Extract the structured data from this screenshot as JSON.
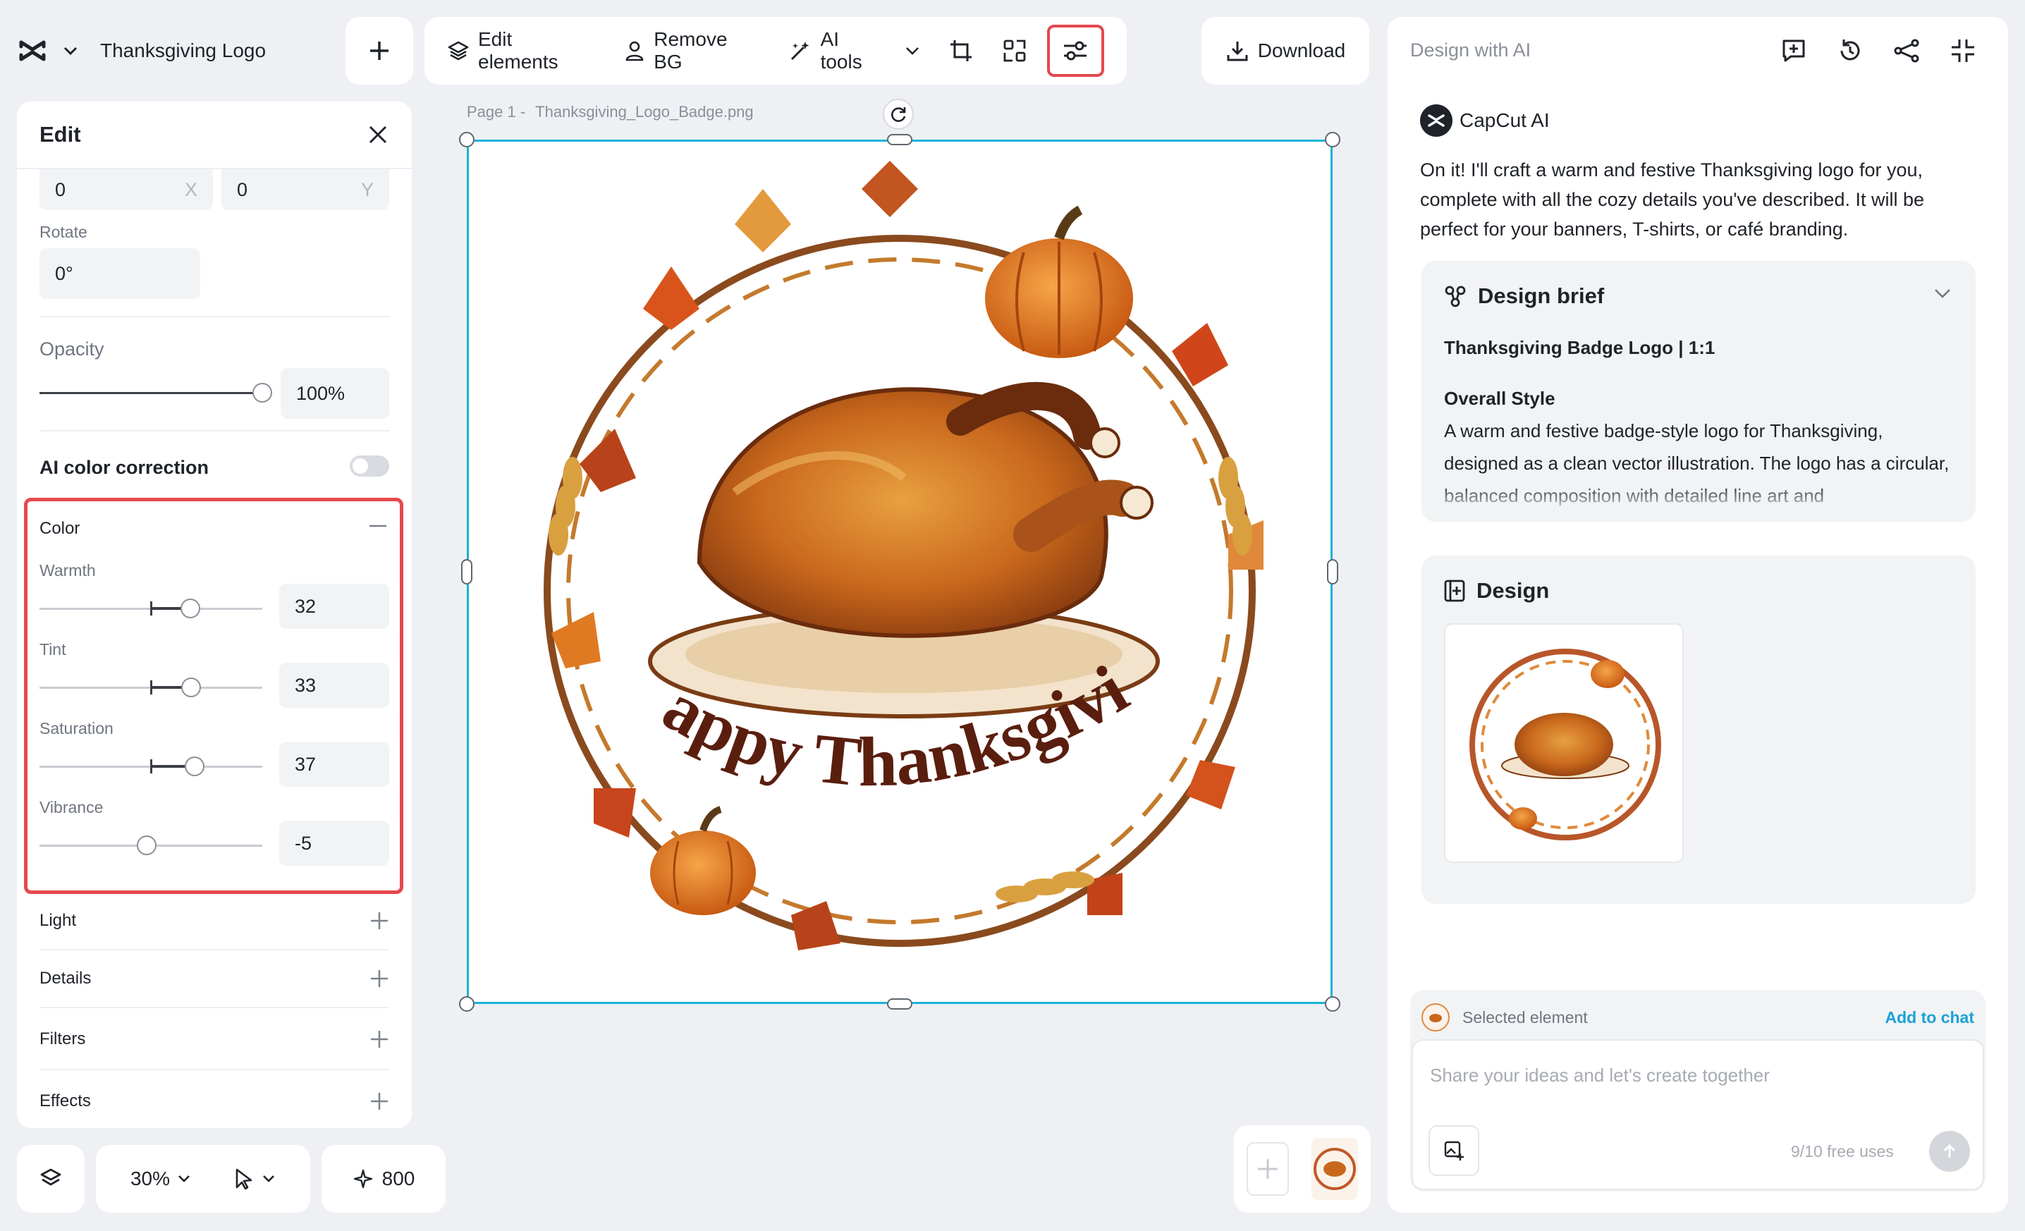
{
  "app": {
    "logo_icon": "capcut-logo-icon",
    "project_title": "Thanksgiving Logo"
  },
  "toolbar": {
    "edit_elements": "Edit elements",
    "remove_bg": "Remove BG",
    "ai_tools": "AI tools",
    "download": "Download"
  },
  "edit_panel": {
    "title": "Edit",
    "position": {
      "x_value": "0",
      "x_label": "X",
      "y_value": "0",
      "y_label": "Y"
    },
    "rotate_label": "Rotate",
    "rotate_value": "0°",
    "opacity_label": "Opacity",
    "opacity_value": "100%",
    "opacity_level": 1.0,
    "ai_color_correction_label": "AI color correction",
    "ai_color_correction_on": false,
    "color": {
      "label": "Color",
      "warmth_label": "Warmth",
      "warmth_value": "32",
      "tint_label": "Tint",
      "tint_value": "33",
      "saturation_label": "Saturation",
      "saturation_value": "37",
      "vibrance_label": "Vibrance",
      "vibrance_value": "-5"
    },
    "sections": [
      "Light",
      "Details",
      "Filters",
      "Effects"
    ]
  },
  "bottom_bar": {
    "zoom": "30%",
    "credits": "800"
  },
  "canvas": {
    "page_label": "Page 1 -",
    "file_name": "Thanksgiving_Logo_Badge.png",
    "logo_text": "Happy Thanksgiving"
  },
  "ai_panel": {
    "title": "Design with AI",
    "assistant_name": "CapCut AI",
    "message": "On it! I'll craft a warm and festive Thanksgiving logo for you, complete with all the cozy details you've described. It will be perfect for your banners, T-shirts, or café branding.",
    "brief": {
      "heading": "Design brief",
      "subtitle": "Thanksgiving Badge Logo | 1:1",
      "style_heading": "Overall Style",
      "style_text": "A warm and festive badge-style logo for Thanksgiving, designed as a clean vector illustration. The logo has a circular, balanced composition with detailed line art and"
    },
    "design_heading": "Design",
    "selected_element_label": "Selected element",
    "add_to_chat": "Add to chat",
    "input_placeholder": "Share your ideas and let's create together",
    "free_uses": "9/10 free uses"
  },
  "colors": {
    "accent_highlight": "#e5484d",
    "selection": "#1ab3d6",
    "link": "#19a2d8"
  }
}
